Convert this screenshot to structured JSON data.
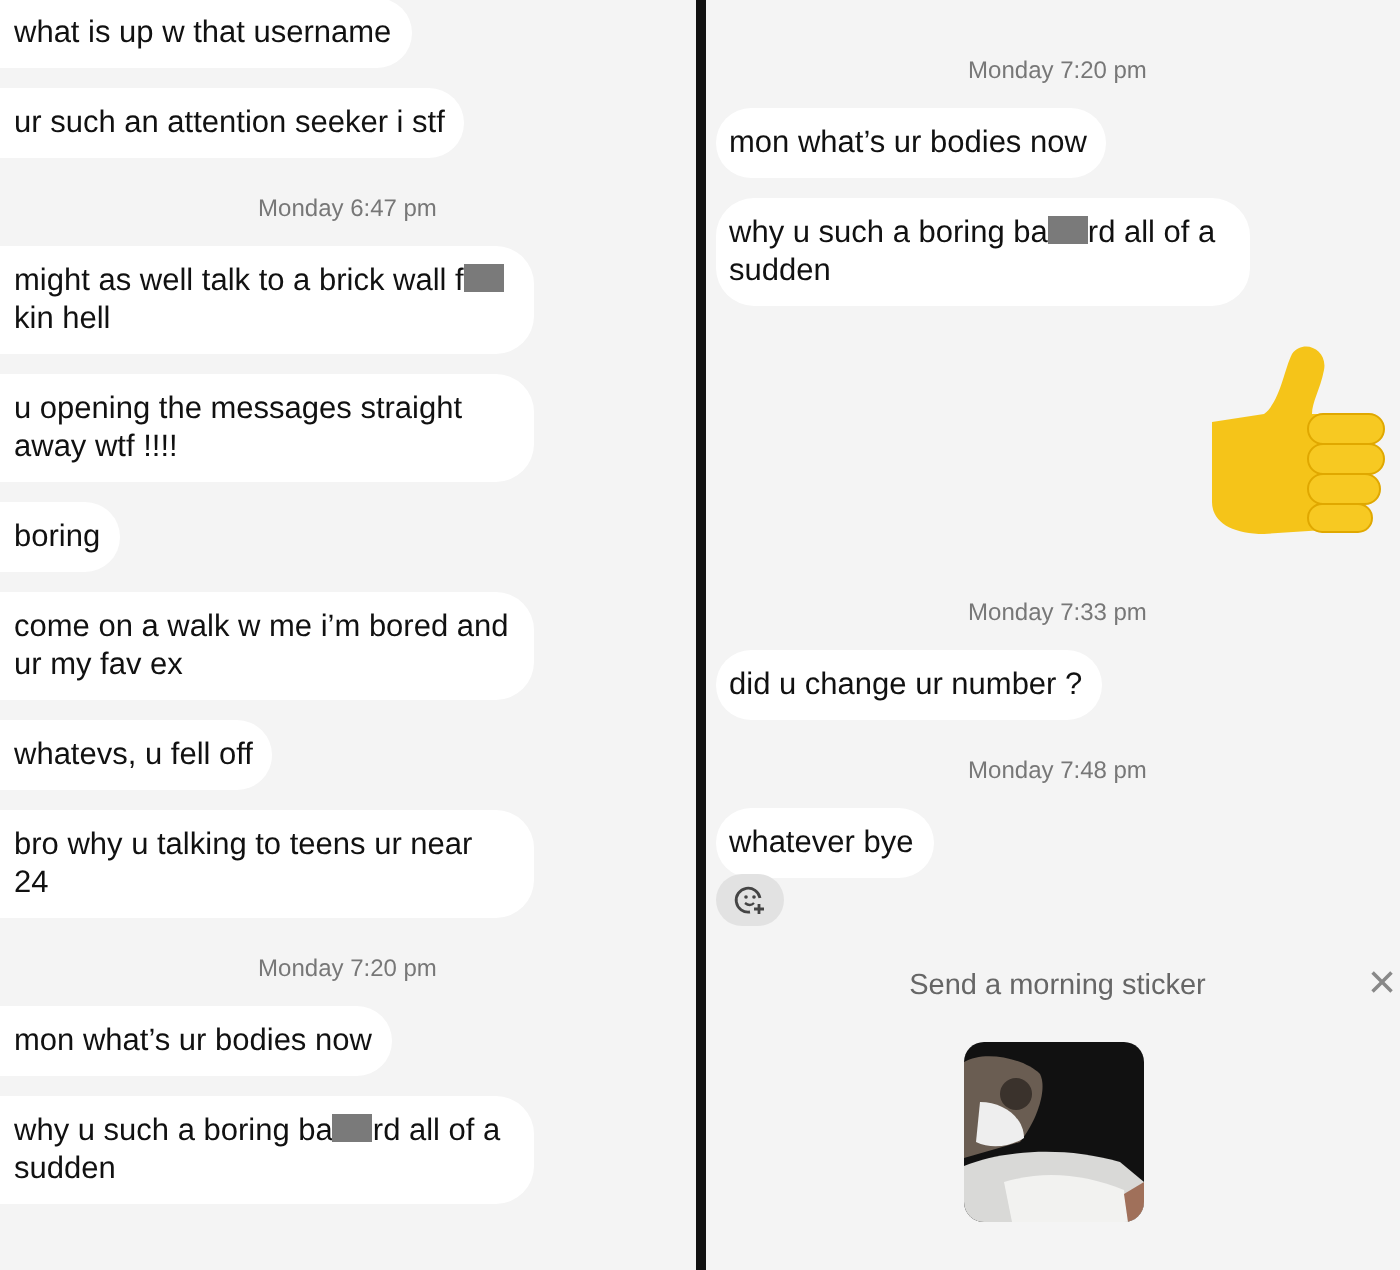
{
  "panels": [
    {
      "items": [
        {
          "kind": "message",
          "segments": [
            {
              "kind": "text",
              "text": "what is up w that username"
            }
          ]
        },
        {
          "kind": "message",
          "segments": [
            {
              "kind": "text",
              "text": "ur such an attention seeker i stf"
            }
          ]
        },
        {
          "kind": "timestamp",
          "text": "Monday 6:47 pm"
        },
        {
          "kind": "message",
          "segments": [
            {
              "kind": "text",
              "text": "might as well talk to a brick wall f"
            },
            {
              "kind": "redacted"
            },
            {
              "kind": "text",
              "text": "kin hell"
            }
          ]
        },
        {
          "kind": "message",
          "segments": [
            {
              "kind": "text",
              "text": "u opening the messages straight away wtf !!!!"
            }
          ]
        },
        {
          "kind": "message",
          "segments": [
            {
              "kind": "text",
              "text": "boring"
            }
          ]
        },
        {
          "kind": "message",
          "segments": [
            {
              "kind": "text",
              "text": "come on a walk w me i’m bored and ur my fav ex"
            }
          ]
        },
        {
          "kind": "message",
          "segments": [
            {
              "kind": "text",
              "text": "whatevs, u fell off"
            }
          ]
        },
        {
          "kind": "message",
          "segments": [
            {
              "kind": "text",
              "text": "bro why u talking to teens ur near 24"
            }
          ]
        },
        {
          "kind": "timestamp",
          "text": "Monday 7:20 pm"
        },
        {
          "kind": "message",
          "segments": [
            {
              "kind": "text",
              "text": "mon what’s ur bodies now"
            }
          ]
        },
        {
          "kind": "message",
          "segments": [
            {
              "kind": "text",
              "text": "why u such a boring ba"
            },
            {
              "kind": "redacted"
            },
            {
              "kind": "text",
              "text": "rd all of a sudden"
            }
          ]
        }
      ]
    },
    {
      "items": [
        {
          "kind": "timestamp",
          "text": "Monday 7:20 pm"
        },
        {
          "kind": "message",
          "segments": [
            {
              "kind": "text",
              "text": "mon what’s ur bodies now"
            }
          ]
        },
        {
          "kind": "message",
          "segments": [
            {
              "kind": "text",
              "text": "why u such a boring ba"
            },
            {
              "kind": "redacted"
            },
            {
              "kind": "text",
              "text": "rd all of a sudden"
            }
          ]
        },
        {
          "kind": "emoji"
        },
        {
          "kind": "timestamp",
          "text": "Monday 7:33 pm"
        },
        {
          "kind": "message",
          "segments": [
            {
              "kind": "text",
              "text": "did u change ur number ?"
            }
          ]
        },
        {
          "kind": "timestamp",
          "text": "Monday 7:48 pm"
        },
        {
          "kind": "message",
          "segments": [
            {
              "kind": "text",
              "text": "whatever bye"
            }
          ]
        },
        {
          "kind": "reaction_button"
        },
        {
          "kind": "sticker_prompt",
          "text": "Send a morning sticker",
          "close": "×"
        },
        {
          "kind": "sticker"
        }
      ]
    }
  ]
}
